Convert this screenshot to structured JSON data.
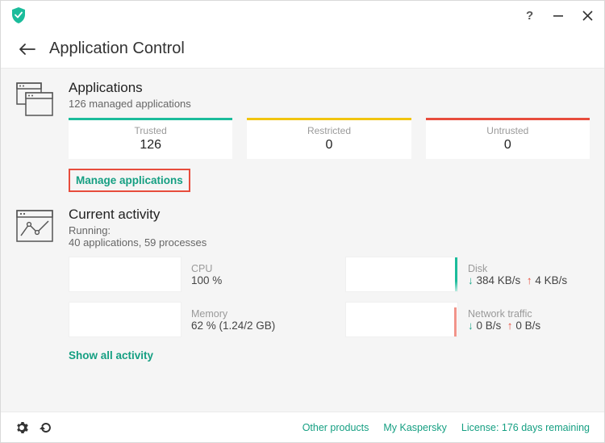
{
  "header": {
    "title": "Application Control"
  },
  "applications": {
    "title": "Applications",
    "subtitle": "126 managed applications",
    "tiles": {
      "trusted": {
        "label": "Trusted",
        "value": "126"
      },
      "restricted": {
        "label": "Restricted",
        "value": "0"
      },
      "untrusted": {
        "label": "Untrusted",
        "value": "0"
      }
    },
    "manage_link": "Manage applications"
  },
  "activity": {
    "title": "Current activity",
    "running_label": "Running:",
    "running_detail": "40 applications, 59 processes",
    "cpu": {
      "label": "CPU",
      "value": "100 %"
    },
    "memory": {
      "label": "Memory",
      "value": "62 % (1.24/2 GB)"
    },
    "disk": {
      "label": "Disk",
      "down": "384 KB/s",
      "up": "4 KB/s"
    },
    "network": {
      "label": "Network traffic",
      "down": "0 B/s",
      "up": "0 B/s"
    },
    "show_all_link": "Show all activity"
  },
  "footer": {
    "other_products": "Other products",
    "my_kaspersky": "My Kaspersky",
    "license": "License: 176 days remaining"
  }
}
